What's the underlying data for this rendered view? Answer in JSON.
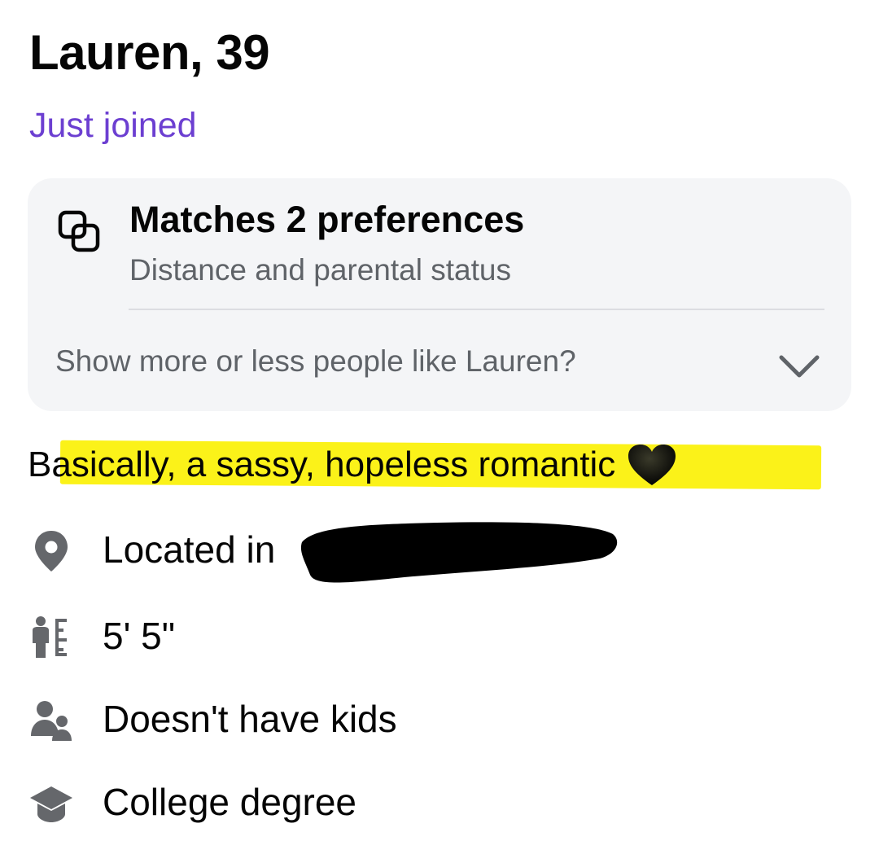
{
  "profile": {
    "name_age": "Lauren, 39",
    "status": "Just joined"
  },
  "preferences": {
    "icon": "overlapping-squares-icon",
    "title": "Matches 2 preferences",
    "subtitle": "Distance and parental status",
    "more_label": "Show more or less people like Lauren?",
    "expand_icon": "chevron-down-icon"
  },
  "bio": {
    "text": "Basically, a sassy, hopeless romantic",
    "emoji": "black-heart-icon",
    "highlight_color": "#fbf219"
  },
  "details": [
    {
      "icon": "location-pin-icon",
      "label": "Located in"
    },
    {
      "icon": "height-icon",
      "label": "5' 5\""
    },
    {
      "icon": "people-icon",
      "label": "Doesn't have kids"
    },
    {
      "icon": "graduation-cap-icon",
      "label": "College degree"
    }
  ],
  "colors": {
    "accent": "#6c3fd1",
    "card_bg": "#f4f5f7",
    "muted_text": "#5f6368",
    "icon_gray": "#65676b",
    "redaction": "#000000"
  }
}
